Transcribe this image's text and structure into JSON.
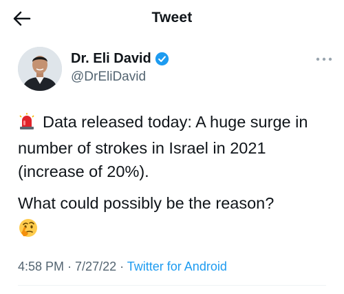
{
  "header": {
    "back_icon": "arrow-left-icon",
    "title": "Tweet"
  },
  "author": {
    "avatar_icon": "profile-photo",
    "display_name": "Dr. Eli David",
    "verified_icon": "verified-badge-icon",
    "handle": "@DrEliDavid",
    "more_icon": "more-horizontal-icon"
  },
  "tweet": {
    "siren_icon": "police-light-emoji",
    "line1": "Data released today: A huge surge in number of strokes in Israel in 2021 (increase of 20%).",
    "line2": "What could possibly be the reason?",
    "thinking_icon": "thinking-face-emoji"
  },
  "meta": {
    "time": "4:58 PM",
    "separator": " · ",
    "date": "7/27/22",
    "source": "Twitter for Android"
  },
  "colors": {
    "text": "#0f1419",
    "secondary": "#536471",
    "accent": "#1d9bf0"
  }
}
